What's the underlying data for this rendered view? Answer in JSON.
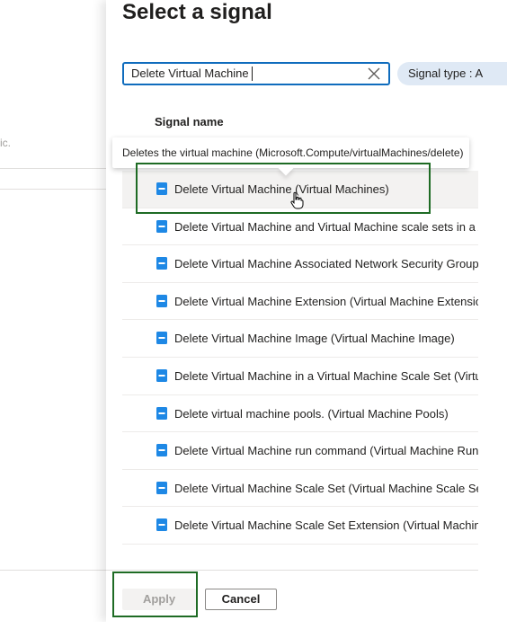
{
  "background": {
    "fragment_text": "ic."
  },
  "panel": {
    "title": "Select a signal",
    "search": {
      "value": "Delete Virtual Machine",
      "placeholder": ""
    },
    "signal_type_pill": "Signal type : A",
    "column_header": "Signal name",
    "tooltip": "Deletes the virtual machine (Microsoft.Compute/virtualMachines/delete)",
    "signals": [
      {
        "label": "Delete Virtual Machine (Virtual Machines)",
        "selected": true
      },
      {
        "label": "Delete Virtual Machine and Virtual Machine scale sets in a A",
        "selected": false
      },
      {
        "label": "Delete Virtual Machine Associated Network Security Group",
        "selected": false
      },
      {
        "label": "Delete Virtual Machine Extension (Virtual Machine Extensio",
        "selected": false
      },
      {
        "label": "Delete Virtual Machine Image (Virtual Machine Image)",
        "selected": false
      },
      {
        "label": "Delete Virtual Machine in a Virtual Machine Scale Set (Virtua",
        "selected": false
      },
      {
        "label": "Delete virtual machine pools. (Virtual Machine Pools)",
        "selected": false
      },
      {
        "label": "Delete Virtual Machine run command (Virtual Machine RunC",
        "selected": false
      },
      {
        "label": "Delete Virtual Machine Scale Set (Virtual Machine Scale Sets",
        "selected": false
      },
      {
        "label": "Delete Virtual Machine Scale Set Extension (Virtual Machine",
        "selected": false
      }
    ],
    "buttons": {
      "apply": "Apply",
      "cancel": "Cancel"
    }
  },
  "colors": {
    "accent": "#0f6cbd",
    "highlight_box": "#1e6b24",
    "icon_blue": "#1e88e5"
  },
  "icons": {
    "signal_icon": "activity-log-icon",
    "clear_icon": "close-icon",
    "cursor": "hand-pointer-icon"
  }
}
